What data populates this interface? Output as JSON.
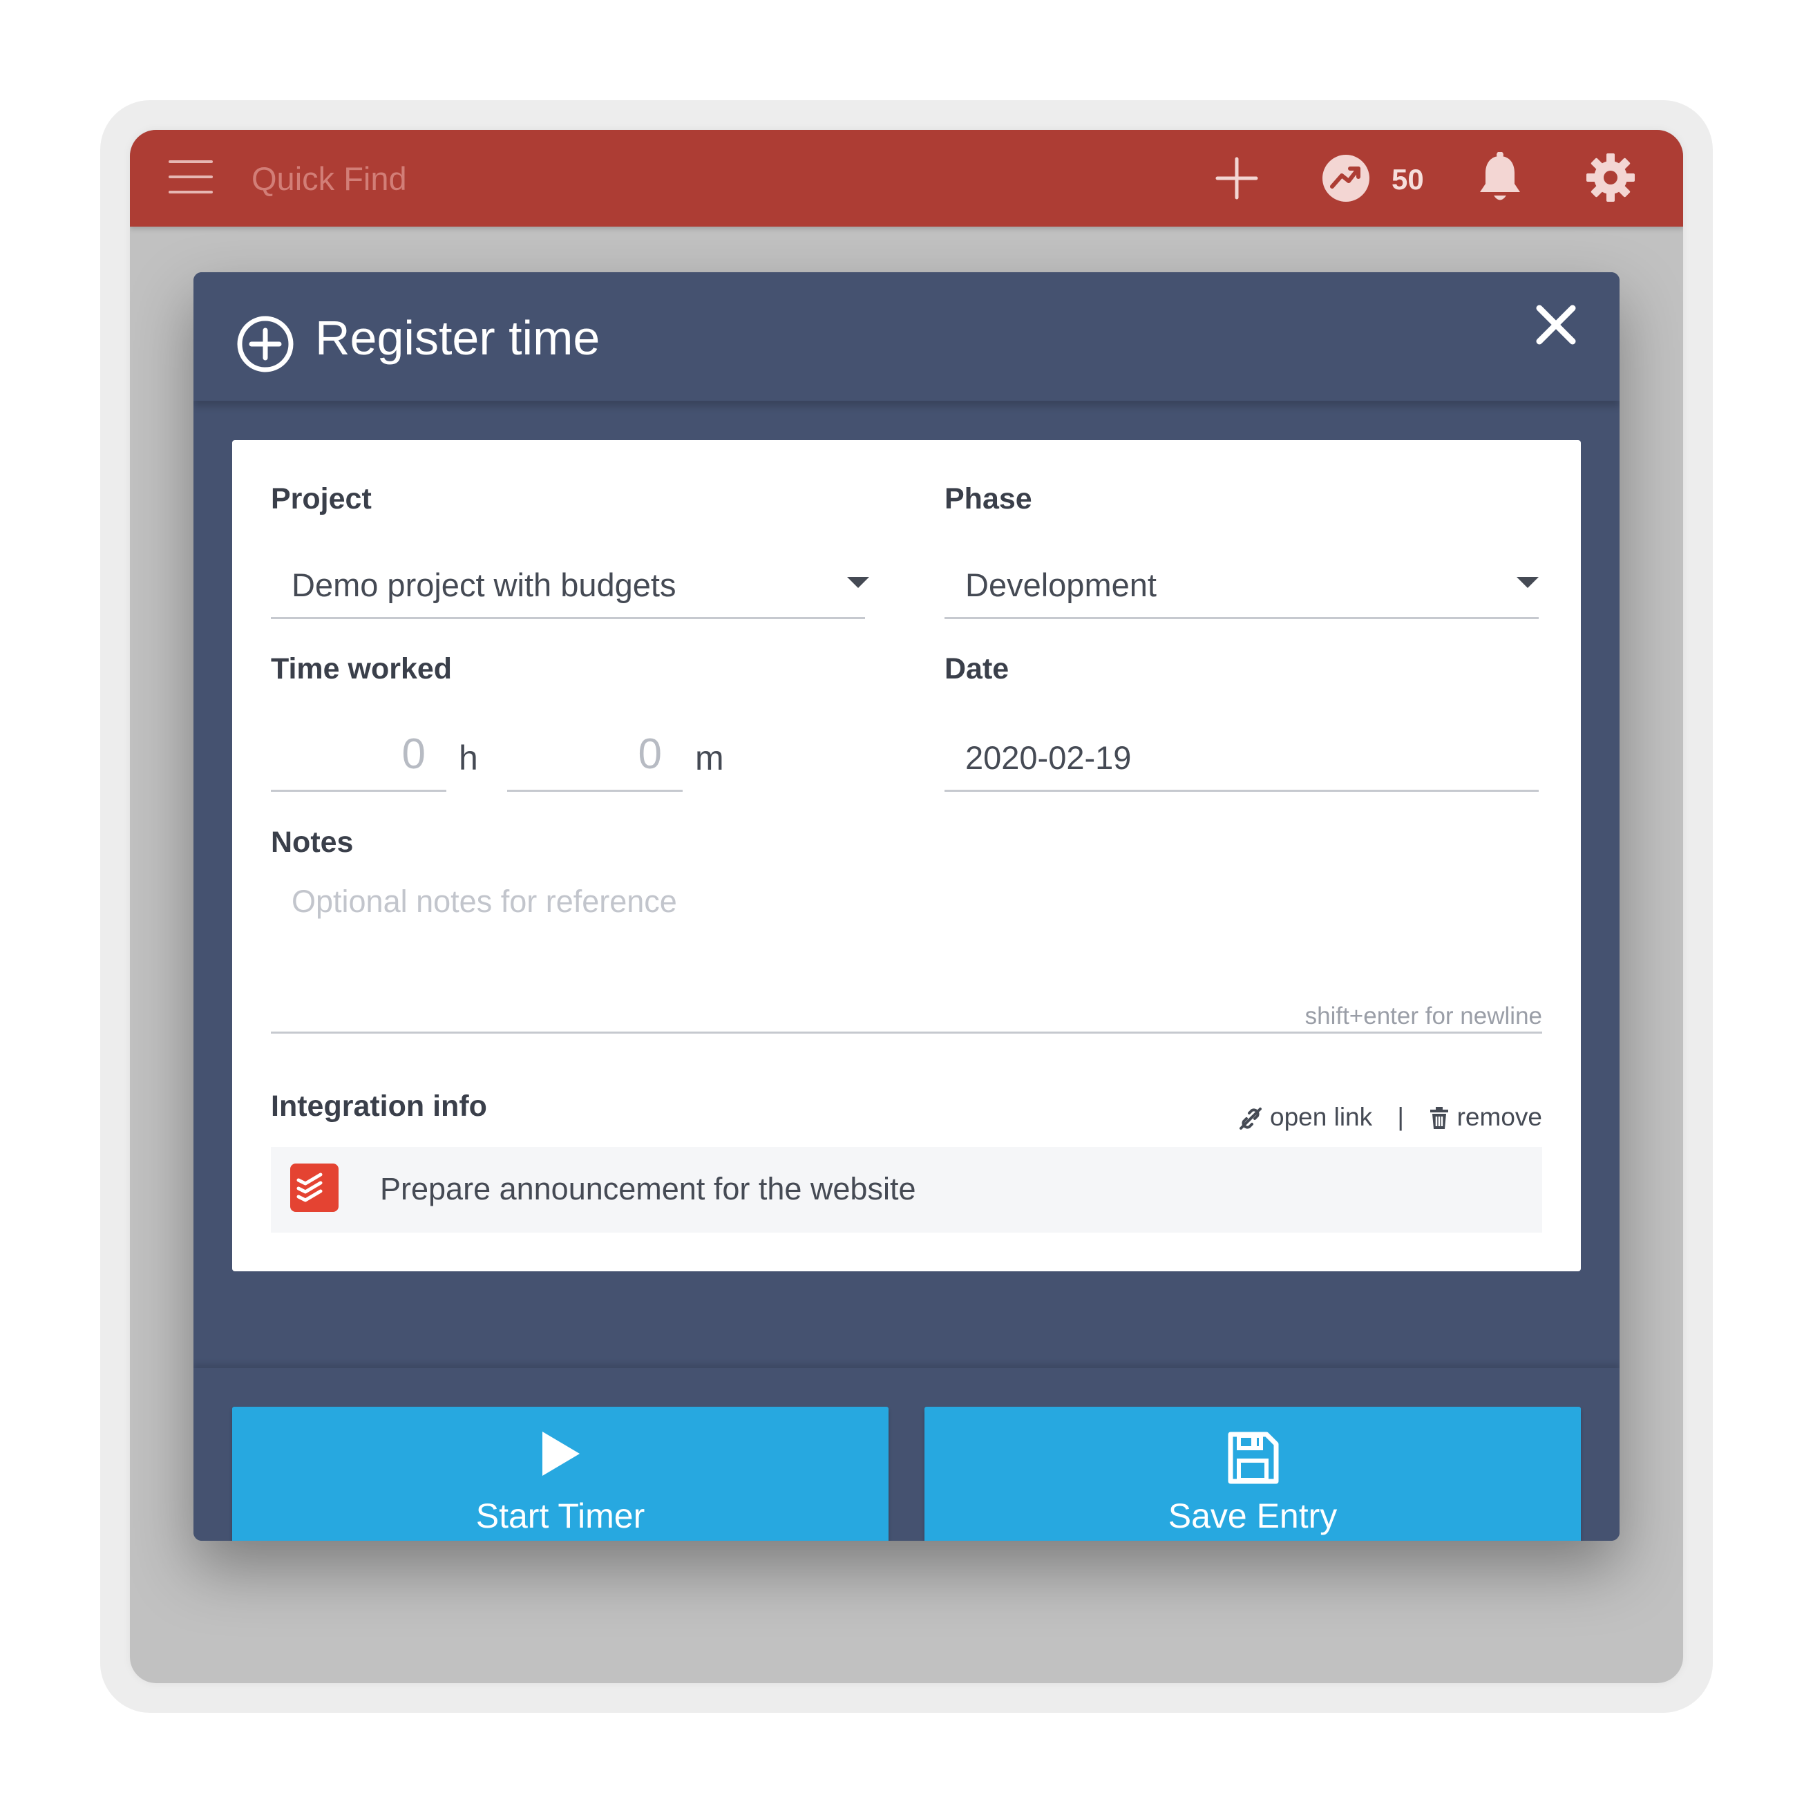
{
  "topbar": {
    "search_placeholder": "Quick Find",
    "points": "50",
    "icons": [
      "menu-icon",
      "plus-icon",
      "trend-icon",
      "bell-icon",
      "gear-icon"
    ]
  },
  "modal": {
    "title": "Register time",
    "icons": [
      "plus-circle-icon",
      "close-icon"
    ]
  },
  "form": {
    "project_label": "Project",
    "project_value": "Demo project with budgets",
    "phase_label": "Phase",
    "phase_value": "Development",
    "time_label": "Time worked",
    "hours_value": "0",
    "hours_unit": "h",
    "minutes_value": "0",
    "minutes_unit": "m",
    "date_label": "Date",
    "date_value": "2020-02-19",
    "notes_label": "Notes",
    "notes_placeholder": "Optional notes for reference",
    "notes_hint": "shift+enter for newline",
    "integration_label": "Integration info",
    "open_link": "open link",
    "separator": "|",
    "remove": "remove",
    "integration_item": "Prepare announcement for the website"
  },
  "buttons": {
    "start_timer": "Start Timer",
    "save_entry": "Save Entry"
  },
  "colors": {
    "topbar": "#ad3d34",
    "modal": "#455270",
    "primary_button": "#27a8e0",
    "integration_brand": "#e44332"
  }
}
